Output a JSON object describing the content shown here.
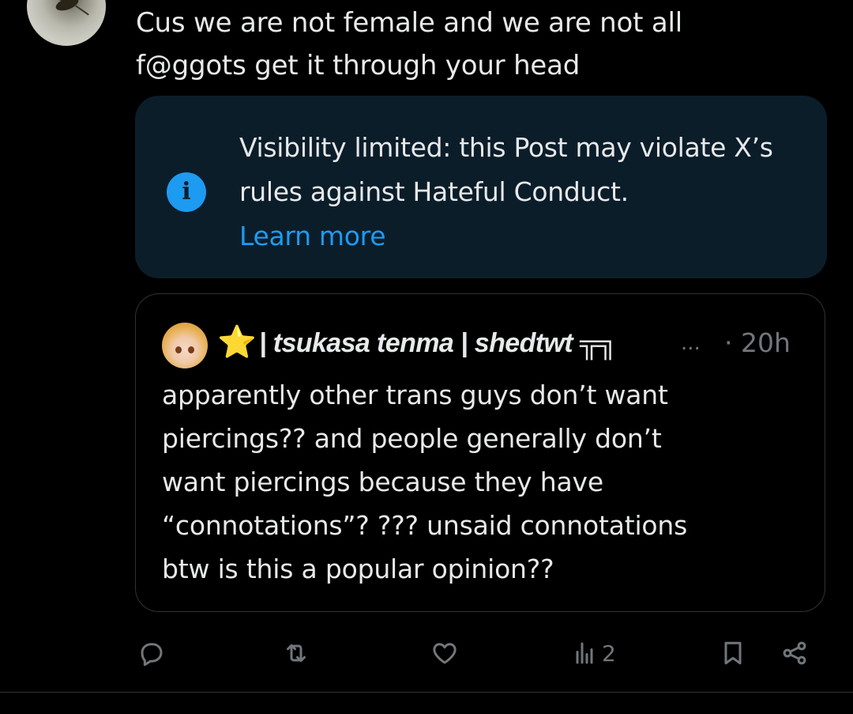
{
  "post": {
    "text": "Cus we are not female and we are not all\nf@ggots get it through your head"
  },
  "notice": {
    "icon": "info-icon",
    "icon_glyph": "i",
    "text": "Visibility limited: this Post may violate X’s rules against Hateful Conduct.",
    "link_label": "Learn more",
    "background": "#0c1d2a",
    "accent": "#1d9bf0"
  },
  "quoted_post": {
    "author_display": "| tsukasa tenma | shedtwt ╦╗",
    "emoji": "⭐",
    "ellipsis": "...",
    "time": "· 20h",
    "text": "apparently other trans guys don’t want\npiercings?? and people generally don’t\nwant piercings because they have\n“connotations”? ??? unsaid connotations\nbtw is this a popular opinion??"
  },
  "actions": {
    "reply_icon": "reply-icon",
    "repost_icon": "repost-icon",
    "like_icon": "like-icon",
    "views_icon": "views-icon",
    "views_count": "2",
    "bookmark_icon": "bookmark-icon",
    "share_icon": "share-icon"
  },
  "colors": {
    "background": "#000000",
    "text": "#e7e9ea",
    "muted": "#71767b",
    "border": "#2f3336"
  }
}
